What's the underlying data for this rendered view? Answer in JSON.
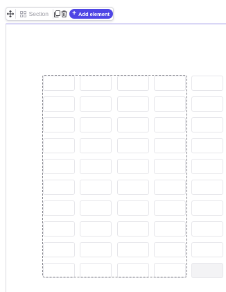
{
  "toolbar": {
    "move_icon": "move-icon",
    "section_icon": "layout-grid-icon",
    "section_label": "Section",
    "duplicate_icon": "copy-icon",
    "delete_icon": "trash-icon",
    "add_element_label": "Add element"
  },
  "grid": {
    "rows": 10,
    "columns": 5
  },
  "colors": {
    "accent": "#4f46e5",
    "section_border": "#9b93e8",
    "selection_border": "#7d7d85"
  }
}
